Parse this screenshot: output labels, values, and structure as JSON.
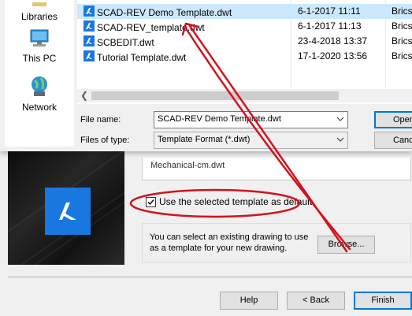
{
  "places": [
    {
      "label": "Libraries",
      "icon": "libraries-icon"
    },
    {
      "label": "This PC",
      "icon": "computer-icon"
    },
    {
      "label": "Network",
      "icon": "network-icon"
    }
  ],
  "files": [
    {
      "name": "SCAD-REV Demo Template.dwt",
      "date": "6-1-2017 11:11",
      "type": "Brics",
      "selected": true
    },
    {
      "name": "SCAD-REV_template.dwt",
      "date": "6-1-2017 11:13",
      "type": "Brics",
      "selected": false
    },
    {
      "name": "SCBEDIT.dwt",
      "date": "23-4-2018 13:37",
      "type": "Brics",
      "selected": false
    },
    {
      "name": "Tutorial Template.dwt",
      "date": "17-1-2020 13:56",
      "type": "Brics",
      "selected": false
    }
  ],
  "file_name": {
    "label": "File name:",
    "value": "SCAD-REV Demo Template.dwt"
  },
  "files_of_type": {
    "label": "Files of type:",
    "value": "Template Format (*.dwt)"
  },
  "dialog_buttons": {
    "open": "Open",
    "cancel": "Cance"
  },
  "wizard": {
    "template_partial": "Mechanical-cm.dwt",
    "default_checkbox": {
      "label": "Use the selected template as default",
      "checked": true
    },
    "info_text": "You can select an existing drawing to use as a template for your new drawing.",
    "browse": "Browse...",
    "help": "Help",
    "back": "< Back",
    "finish": "Finish"
  },
  "colors": {
    "annotation": "#d0141e",
    "selection": "#cce8ff",
    "brand": "#1878e0",
    "accent": "#0078d7"
  }
}
